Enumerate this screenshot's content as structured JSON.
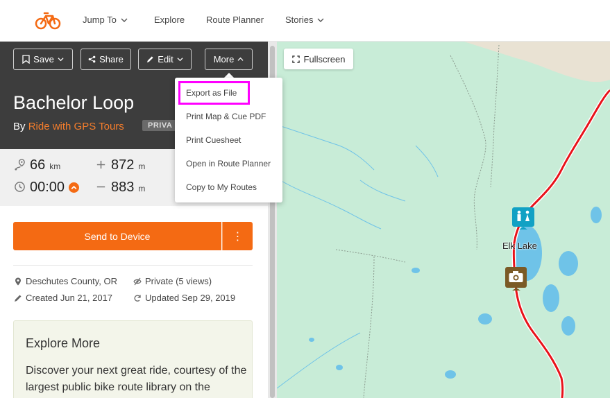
{
  "nav": {
    "items": [
      {
        "label": "Jump To",
        "has_chevron": true
      },
      {
        "label": "Explore",
        "has_chevron": false
      },
      {
        "label": "Route Planner",
        "has_chevron": false
      },
      {
        "label": "Stories",
        "has_chevron": true
      }
    ]
  },
  "toolbar": {
    "save_label": "Save",
    "share_label": "Share",
    "edit_label": "Edit",
    "more_label": "More"
  },
  "route": {
    "title": "Bachelor Loop",
    "by_prefix": "By",
    "author": "Ride with GPS Tours",
    "privacy_tag": "PRIVA"
  },
  "stats": {
    "distance": "66",
    "distance_unit": "km",
    "elevation_gain": "872",
    "gain_unit": "m",
    "duration": "00:00",
    "elevation_loss": "883",
    "loss_unit": "m"
  },
  "actions": {
    "send_label": "Send to Device",
    "more_icon": "⋮"
  },
  "meta": {
    "location": "Deschutes County, OR",
    "privacy": "Private (5 views)",
    "created": "Created Jun 21, 2017",
    "updated": "Updated Sep 29, 2019"
  },
  "explore": {
    "heading": "Explore More",
    "body": "Discover your next great ride, courtesy of the largest public bike route library on the"
  },
  "dropdown": {
    "items": [
      "Export as File",
      "Print Map & Cue PDF",
      "Print Cuesheet",
      "Open in Route Planner",
      "Copy to My Routes"
    ]
  },
  "map": {
    "fullscreen_label": "Fullscreen",
    "place_label": "Elk Lake",
    "route_color": "#e8121a",
    "water_color": "#6fc3e8",
    "land_color": "#c8ecd7"
  },
  "colors": {
    "accent": "#f46a13",
    "highlight": "#ff00ff"
  }
}
